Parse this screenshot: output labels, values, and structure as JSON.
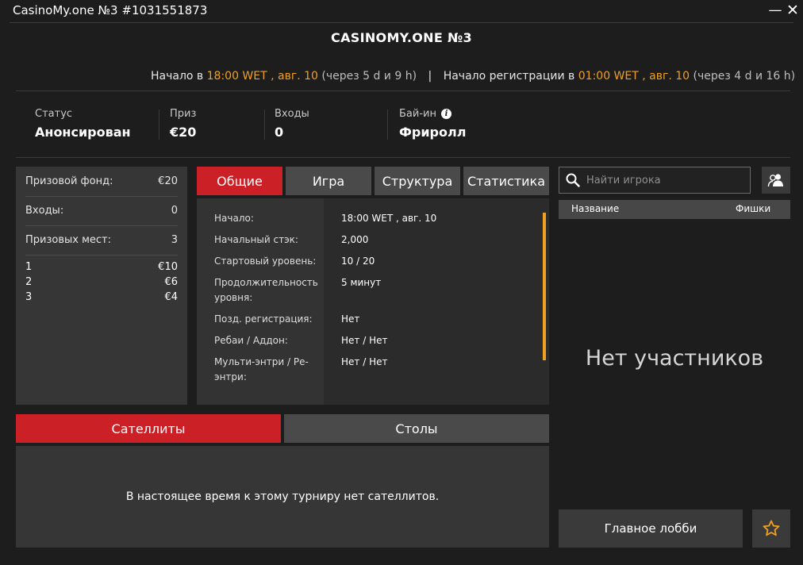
{
  "window": {
    "title": "CasinoMy.one №3 #1031551873",
    "minimize_label": "—",
    "close_label": "✕"
  },
  "tournament": {
    "name": "CASINOMY.ONE №3"
  },
  "schedule": {
    "start_prefix": "Начало в",
    "start_time": "18:00 WET , авг. 10",
    "start_countdown": "(через 5 d и 9 h)",
    "separator": "|",
    "reg_prefix": "Начало регистрации в",
    "reg_time": "01:00 WET , авг. 10",
    "reg_countdown": "(через 4 d и 16 h)"
  },
  "stats": {
    "status_label": "Статус",
    "status_value": "Анонсирован",
    "prize_label": "Приз",
    "prize_value": "€20",
    "entries_label": "Входы",
    "entries_value": "0",
    "buyin_label": "Бай-ин",
    "buyin_info_icon": "i",
    "buyin_value": "Фриролл"
  },
  "prize_pool": {
    "fund_label": "Призовой фонд:",
    "fund_value": "€20",
    "entries_label": "Входы:",
    "entries_value": "0",
    "places_label": "Призовых мест:",
    "places_value": "3",
    "payouts": [
      {
        "place": "1",
        "amount": "€10"
      },
      {
        "place": "2",
        "amount": "€6"
      },
      {
        "place": "3",
        "amount": "€4"
      }
    ]
  },
  "tabs": {
    "general": "Общие",
    "game": "Игра",
    "structure": "Структура",
    "statistics": "Статистика",
    "active": "general"
  },
  "details": [
    {
      "label": "Начало:",
      "value": "18:00 WET , авг. 10"
    },
    {
      "label": "Начальный стэк:",
      "value": "2,000"
    },
    {
      "label": "Стартовый уровень:",
      "value": "10 / 20"
    },
    {
      "label": "Продолжительность уровня:",
      "value": "5 минут"
    },
    {
      "label": "Позд. регистрация:",
      "value": "Нет"
    },
    {
      "label": "Ребаи / Аддон:",
      "value": "Нет / Нет"
    },
    {
      "label": "Мульти-энтри / Ре-энтри:",
      "value": "Нет / Нет"
    }
  ],
  "bottom_tabs": {
    "satellites": "Сателлиты",
    "tables": "Столы",
    "active": "satellites"
  },
  "satellites_message": "В настоящее время к этому турниру нет сателлитов.",
  "players": {
    "search_placeholder": "Найти игрока",
    "col_name": "Название",
    "col_chips": "Фишки",
    "empty_message": "Нет участников"
  },
  "footer": {
    "main_lobby_label": "Главное лобби"
  },
  "colors": {
    "accent_red": "#cc2027",
    "highlight_orange": "#f0a020",
    "background": "#1d1d1d",
    "panel": "#363636",
    "star": "#f0a020"
  },
  "icons": {
    "search": "search-icon",
    "players": "players-icon",
    "favorite": "star-icon",
    "info": "info-icon"
  }
}
